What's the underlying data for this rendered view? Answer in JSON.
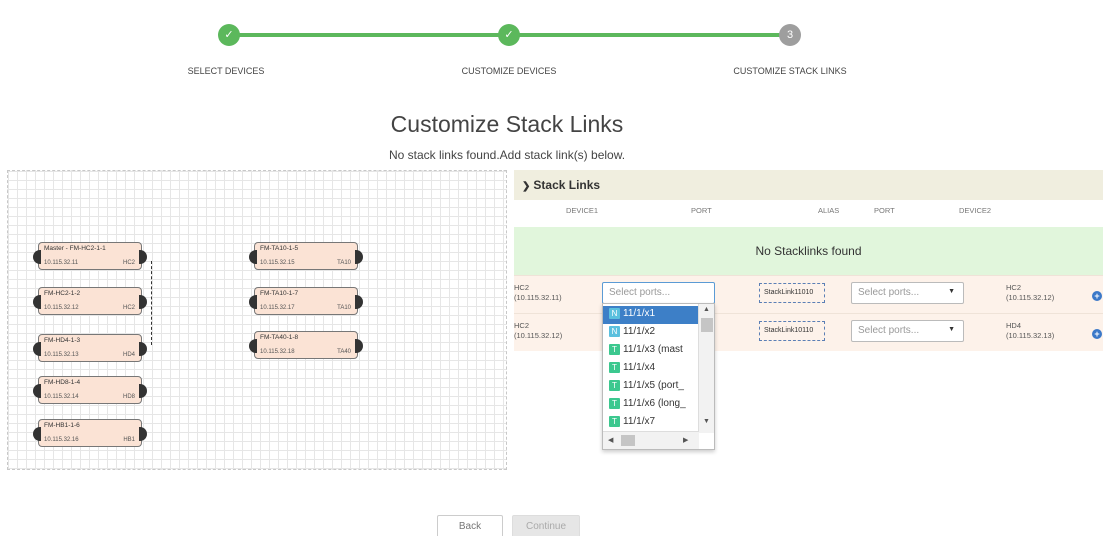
{
  "wizard": {
    "steps": [
      {
        "label": "SELECT DEVICES",
        "marker": "✓",
        "state": "done"
      },
      {
        "label": "CUSTOMIZE DEVICES",
        "marker": "✓",
        "state": "done"
      },
      {
        "label": "CUSTOMIZE STACK LINKS",
        "marker": "3",
        "state": "current"
      }
    ]
  },
  "page": {
    "title": "Customize Stack Links",
    "subtitle": "No stack links found.Add stack link(s) below."
  },
  "topology": {
    "devices": [
      {
        "name": "Master - FM-HC2-1-1",
        "ip": "10.115.32.11",
        "type": "HC2"
      },
      {
        "name": "FM-HC2-1-2",
        "ip": "10.115.32.12",
        "type": "HC2"
      },
      {
        "name": "FM-HD4-1-3",
        "ip": "10.115.32.13",
        "type": "HD4"
      },
      {
        "name": "FM-HD8-1-4",
        "ip": "10.115.32.14",
        "type": "HD8"
      },
      {
        "name": "FM-HB1-1-6",
        "ip": "10.115.32.16",
        "type": "HB1"
      },
      {
        "name": "FM-TA10-1-5",
        "ip": "10.115.32.15",
        "type": "TA10"
      },
      {
        "name": "FM-TA10-1-7",
        "ip": "10.115.32.17",
        "type": "TA10"
      },
      {
        "name": "FM-TA40-1-8",
        "ip": "10.115.32.18",
        "type": "TA40"
      }
    ]
  },
  "stack_links": {
    "header": "Stack Links",
    "columns": {
      "device1": "DEVICE1",
      "port1": "PORT",
      "alias": "ALIAS",
      "port2": "PORT",
      "device2": "DEVICE2"
    },
    "empty_message": "No Stacklinks found",
    "rows": [
      {
        "device1_name": "HC2",
        "device1_ip": "(10.115.32.11)",
        "port1_placeholder": "Select ports...",
        "alias": "StackLink11010",
        "port2_placeholder": "Select ports...",
        "device2_name": "HC2",
        "device2_ip": "(10.115.32.12)"
      },
      {
        "device1_name": "HC2",
        "device1_ip": "(10.115.32.12)",
        "port1_placeholder": "Select ports...",
        "alias": "StackLink10110",
        "port2_placeholder": "Select ports...",
        "device2_name": "HD4",
        "device2_ip": "(10.115.32.13)"
      }
    ]
  },
  "port_dropdown": {
    "options": [
      {
        "badge": "N",
        "label": "11/1/x1",
        "selected": true
      },
      {
        "badge": "N",
        "label": "11/1/x2",
        "selected": false
      },
      {
        "badge": "T",
        "label": "11/1/x3 (mast",
        "selected": false
      },
      {
        "badge": "T",
        "label": "11/1/x4",
        "selected": false
      },
      {
        "badge": "T",
        "label": "11/1/x5 (port_",
        "selected": false
      },
      {
        "badge": "T",
        "label": "11/1/x6 (long_",
        "selected": false
      },
      {
        "badge": "T",
        "label": "11/1/x7",
        "selected": false
      }
    ]
  },
  "footer": {
    "back_label": "Back",
    "continue_label": "Continue"
  },
  "colors": {
    "step_done": "#5cb85c",
    "step_todo": "#9e9e9e",
    "selection": "#3d7fc7",
    "badge_n": "#5bc0de",
    "badge_t": "#3cc88f"
  }
}
